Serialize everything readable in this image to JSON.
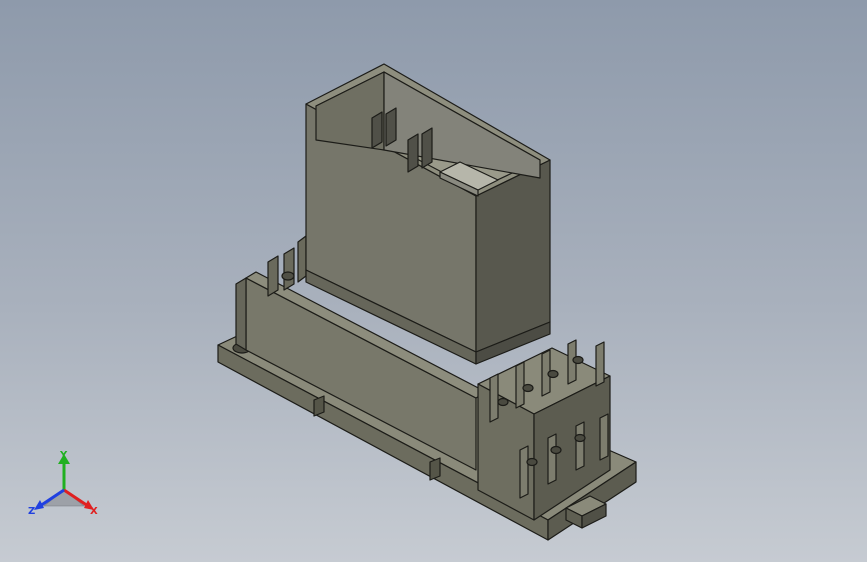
{
  "viewport": {
    "background_top": "#8e9aab",
    "background_bottom": "#c6cbd2",
    "model_color": "#7a7a6c",
    "model_edge_color": "#1c1c18"
  },
  "triad": {
    "x_label": "X",
    "y_label": "Y",
    "z_label": "Z",
    "x_color": "#e02020",
    "y_color": "#20b020",
    "z_color": "#2040e0"
  }
}
